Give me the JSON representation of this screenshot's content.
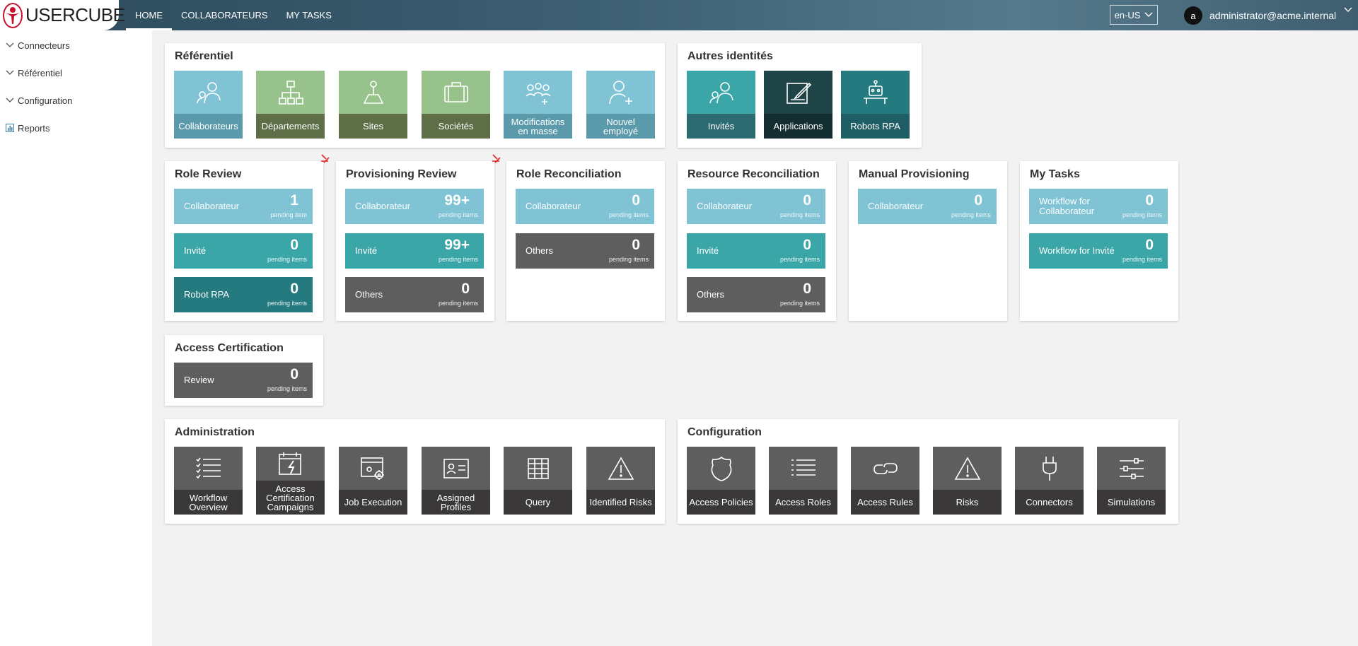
{
  "header": {
    "logo_text": "USERCUBE",
    "nav": [
      "HOME",
      "COLLABORATEURS",
      "MY TASKS"
    ],
    "language": "en-US",
    "avatar_letter": "a",
    "user_email": "administrator@acme.internal"
  },
  "sidebar": {
    "items": [
      "Connecteurs",
      "Référentiel",
      "Configuration",
      "Reports"
    ]
  },
  "referentiel": {
    "title": "Référentiel",
    "tiles": [
      "Collaborateurs",
      "Départements",
      "Sites",
      "Sociétés",
      "Modifications en masse",
      "Nouvel employé"
    ]
  },
  "autres": {
    "title": "Autres identités",
    "tiles": [
      "Invités",
      "Applications",
      "Robots RPA"
    ]
  },
  "role_review": {
    "title": "Role Review",
    "rows": [
      {
        "label": "Collaborateur",
        "count": "1",
        "sub": "pending item"
      },
      {
        "label": "Invité",
        "count": "0",
        "sub": "pending items"
      },
      {
        "label": "Robot RPA",
        "count": "0",
        "sub": "pending items"
      }
    ]
  },
  "provisioning_review": {
    "title": "Provisioning Review",
    "rows": [
      {
        "label": "Collaborateur",
        "count": "99+",
        "sub": "pending items"
      },
      {
        "label": "Invité",
        "count": "99+",
        "sub": "pending items"
      },
      {
        "label": "Others",
        "count": "0",
        "sub": "pending items"
      }
    ]
  },
  "role_reconciliation": {
    "title": "Role Reconciliation",
    "rows": [
      {
        "label": "Collaborateur",
        "count": "0",
        "sub": "pending items"
      },
      {
        "label": "Others",
        "count": "0",
        "sub": "pending items"
      }
    ]
  },
  "resource_reconciliation": {
    "title": "Resource Reconciliation",
    "rows": [
      {
        "label": "Collaborateur",
        "count": "0",
        "sub": "pending items"
      },
      {
        "label": "Invité",
        "count": "0",
        "sub": "pending items"
      },
      {
        "label": "Others",
        "count": "0",
        "sub": "pending items"
      }
    ]
  },
  "manual_provisioning": {
    "title": "Manual Provisioning",
    "rows": [
      {
        "label": "Collaborateur",
        "count": "0",
        "sub": "pending items"
      }
    ]
  },
  "my_tasks": {
    "title": "My Tasks",
    "rows": [
      {
        "label": "Workflow for Collaborateur",
        "count": "0",
        "sub": "pending items"
      },
      {
        "label": "Workflow for Invité",
        "count": "0",
        "sub": "pending items"
      }
    ]
  },
  "access_certification": {
    "title": "Access Certification",
    "rows": [
      {
        "label": "Review",
        "count": "0",
        "sub": "pending items"
      }
    ]
  },
  "administration": {
    "title": "Administration",
    "tiles": [
      "Workflow Overview",
      "Access Certification Campaigns",
      "Job Execution",
      "Assigned Profiles",
      "Query",
      "Identified Risks"
    ]
  },
  "configuration": {
    "title": "Configuration",
    "tiles": [
      "Access Policies",
      "Access Roles",
      "Access Rules",
      "Risks",
      "Connectors",
      "Simulations"
    ]
  },
  "colors": {
    "header": "#3d6072",
    "light_blue": "#7fc3d4",
    "teal": "#3aa6a8",
    "dark_teal": "#257a80",
    "green": "#97c28b",
    "dark_green": "#5e6e47",
    "grey": "#5e5e5e",
    "dark_grey": "#3a3838",
    "badge": "#e32626"
  }
}
